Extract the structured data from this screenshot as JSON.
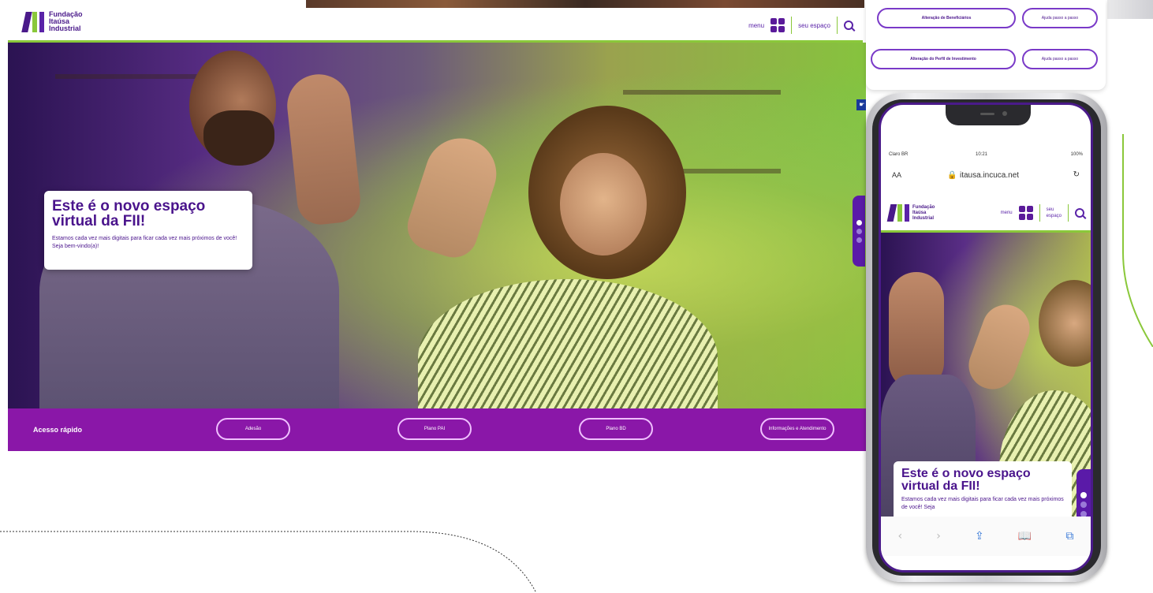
{
  "desktop": {
    "header": {
      "logo_text": [
        "Fundação",
        "Itaúsa",
        "Industrial"
      ],
      "menu_label": "menu",
      "account_label": "seu espaço"
    },
    "hero": {
      "title": "Este é o novo espaço virtual da FII!",
      "subtitle": "Estamos cada vez mais digitais para ficar cada vez mais próximos de você! Seja bem-vindo(a)!"
    },
    "quick_access": {
      "title": "Acesso rápido",
      "buttons": [
        "Adesão",
        "Plano PAI",
        "Plano BD",
        "Informações e Atendimento"
      ]
    }
  },
  "top_card": {
    "rows": [
      {
        "primary": "Alteração de Beneficiários",
        "secondary": "Ajuda passo a passo"
      },
      {
        "primary": "Alteração do Perfil de Investimento",
        "secondary": "Ajuda passo a passo"
      }
    ]
  },
  "phone": {
    "status": {
      "carrier": "Claro BR",
      "time": "10:21",
      "battery": "100%"
    },
    "browser": {
      "text_size": "AA",
      "url": "itausa.incuca.net"
    },
    "header": {
      "logo_text": [
        "Fundação",
        "Itaúsa",
        "Industrial"
      ],
      "menu_label": "menu",
      "account_label": [
        "seu",
        "espaço"
      ]
    },
    "card": {
      "title": "Este é o novo espaço virtual da FII!",
      "subtitle": "Estamos cada vez mais digitais para ficar cada vez mais próximos de você! Seja"
    }
  },
  "colors": {
    "brand_purple": "#4a148c",
    "accent_green": "#8ac83a",
    "quick_bar": "#8a17a8"
  }
}
